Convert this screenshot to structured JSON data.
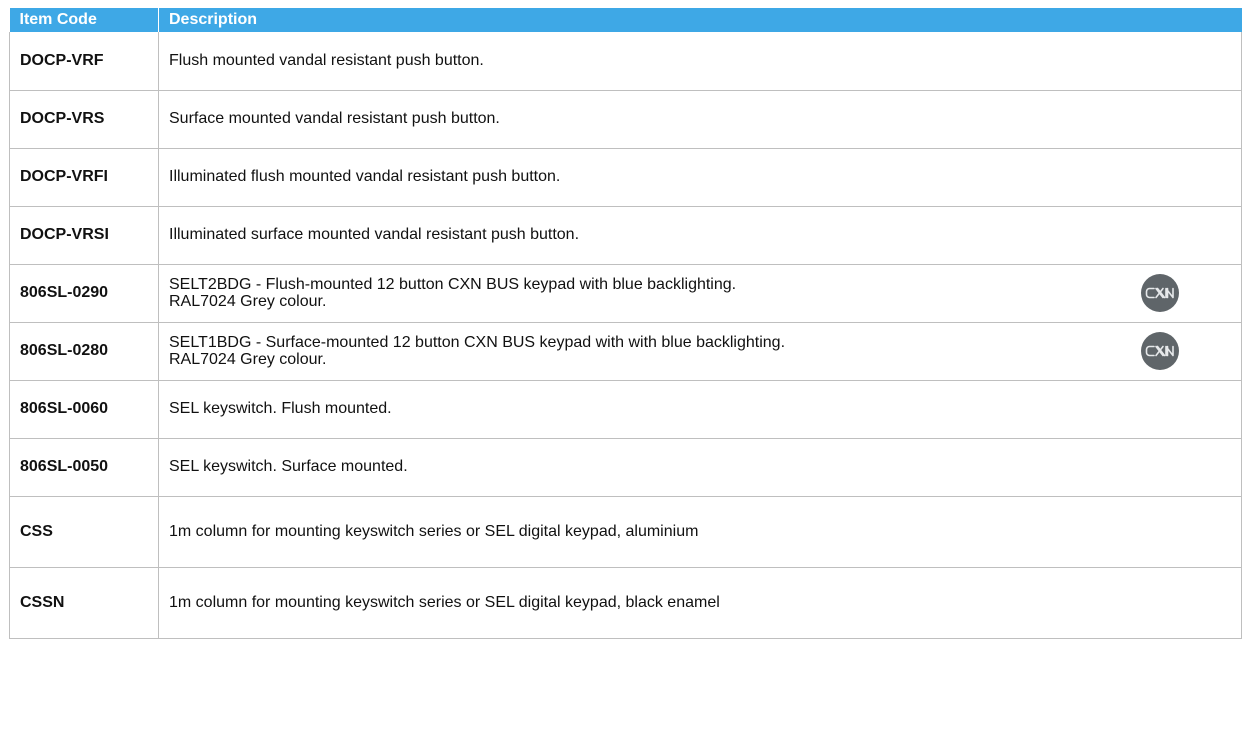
{
  "table": {
    "headers": [
      "Item Code",
      "Description"
    ],
    "rows": [
      {
        "code": "DOCP-VRF",
        "desc": "Flush mounted vandal resistant push button.",
        "desc2": "",
        "badge": ""
      },
      {
        "code": "DOCP-VRS",
        "desc": "Surface mounted vandal resistant push button.",
        "desc2": "",
        "badge": ""
      },
      {
        "code": "DOCP-VRFI",
        "desc": "Illuminated flush mounted vandal resistant push button.",
        "desc2": "",
        "badge": ""
      },
      {
        "code": "DOCP-VRSI",
        "desc": "Illuminated surface mounted vandal resistant push button.",
        "desc2": "",
        "badge": ""
      },
      {
        "code": "806SL-0290",
        "desc": "SELT2BDG - Flush-mounted 12 button CXN BUS keypad with blue backlighting.",
        "desc2": "RAL7024 Grey colour.",
        "badge": "CXN"
      },
      {
        "code": "806SL-0280",
        "desc": "SELT1BDG - Surface-mounted 12 button CXN BUS keypad with with blue backlighting.",
        "desc2": "RAL7024 Grey colour.",
        "badge": "CXN"
      },
      {
        "code": "806SL-0060",
        "desc": "SEL keyswitch. Flush mounted.",
        "desc2": "",
        "badge": ""
      },
      {
        "code": "806SL-0050",
        "desc": "SEL keyswitch. Surface mounted.",
        "desc2": "",
        "badge": ""
      },
      {
        "code": "CSS",
        "desc": "1m column for mounting keyswitch series or SEL digital keypad, aluminium",
        "desc2": "",
        "badge": ""
      },
      {
        "code": "CSSN",
        "desc": "1m column for mounting keyswitch series or SEL digital keypad, black enamel",
        "desc2": "",
        "badge": ""
      }
    ]
  },
  "colors": {
    "header_bg": "#3ea8e6",
    "header_text": "#ffffff",
    "badge_bg": "#5f6569",
    "border": "#bfbfbf"
  }
}
